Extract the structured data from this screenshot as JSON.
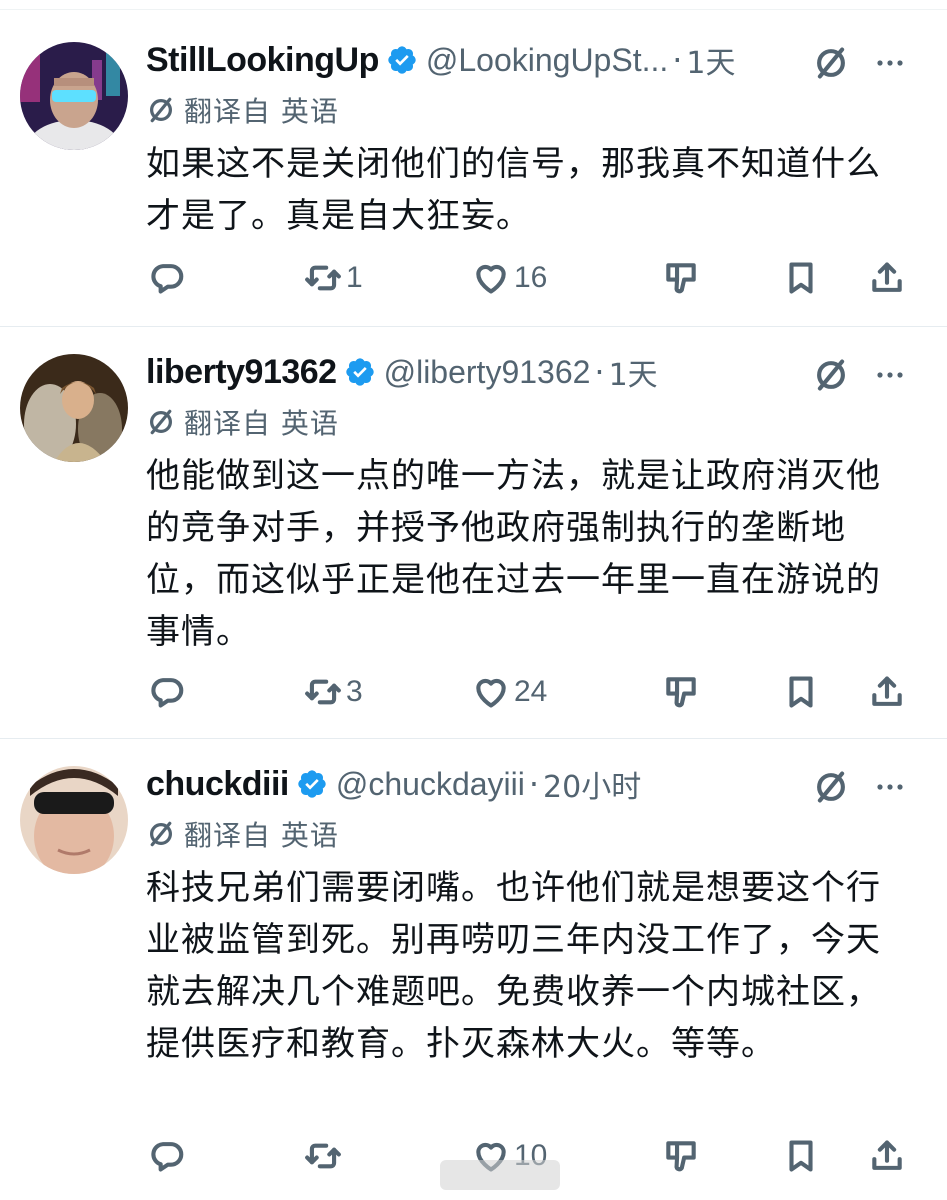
{
  "translate_label": "翻译自 英语",
  "tweets": [
    {
      "display_name": "StillLookingUp",
      "handle": "@LookingUpSt...",
      "separator": "·",
      "time": "1天",
      "text": "如果这不是关闭他们的信号，那我真不知道什么才是了。真是自大狂妄。",
      "retweets": "1",
      "likes": "16",
      "replies": ""
    },
    {
      "display_name": "liberty91362",
      "handle": "@liberty91362",
      "separator": "·",
      "time": "1天",
      "text": "他能做到这一点的唯一方法，就是让政府消灭他的竞争对手，并授予他政府强制执行的垄断地位，而这似乎正是他在过去一年里一直在游说的事情。",
      "retweets": "3",
      "likes": "24",
      "replies": ""
    },
    {
      "display_name": "chuckdiii",
      "handle": "@chuckdayiii",
      "separator": "·",
      "time": "20小时",
      "text": "科技兄弟们需要闭嘴。也许他们就是想要这个行业被监管到死。别再唠叨三年内没工作了，今天就去解决几个难题吧。免费收养一个内城社区，提供医疗和教育。扑灭森林大火。等等。",
      "retweets": "",
      "likes": "10",
      "replies": ""
    }
  ],
  "colors": {
    "verified": "#1d9bf0",
    "secondary_text": "#536471",
    "primary_text": "#0f1419",
    "divider": "#e6ecf0"
  },
  "icons": [
    "verified-badge-icon",
    "grok-icon",
    "more-icon",
    "translate-icon",
    "reply-icon",
    "retweet-icon",
    "like-icon",
    "downvote-icon",
    "bookmark-icon",
    "share-icon"
  ]
}
